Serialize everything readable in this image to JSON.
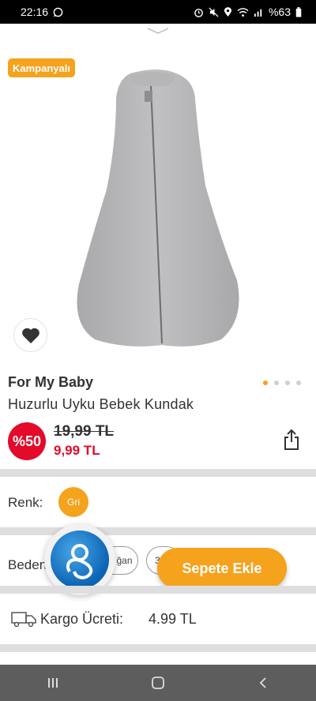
{
  "status_bar": {
    "time": "22:16",
    "battery": "%63"
  },
  "product": {
    "campaign_badge": "Kampanyalı",
    "brand": "For My Baby",
    "name": "Huzurlu Uyku Bebek Kundak",
    "discount": "%50",
    "old_price": "19,99 TL",
    "new_price": "9,99 TL",
    "image_dots": 4,
    "active_dot": 0
  },
  "color_row": {
    "label": "Renk:",
    "selected": "Gri"
  },
  "size_row": {
    "label": "Beden",
    "options": [
      "ğan",
      "3"
    ]
  },
  "cart_button": "Sepete Ekle",
  "shipping": {
    "label": "Kargo Ücreti:",
    "value": "4.99 TL"
  },
  "colors": {
    "accent": "#f5a21d",
    "discount_red": "#e30a2a",
    "separator": "#dedede"
  },
  "icons": [
    "whatsapp-icon",
    "alarm-icon",
    "mute-icon",
    "location-icon",
    "wifi-icon",
    "signal-icon",
    "battery-icon",
    "chevron-down-icon",
    "heart-icon",
    "share-icon",
    "truck-icon",
    "recent-apps-icon",
    "home-icon",
    "back-icon"
  ]
}
